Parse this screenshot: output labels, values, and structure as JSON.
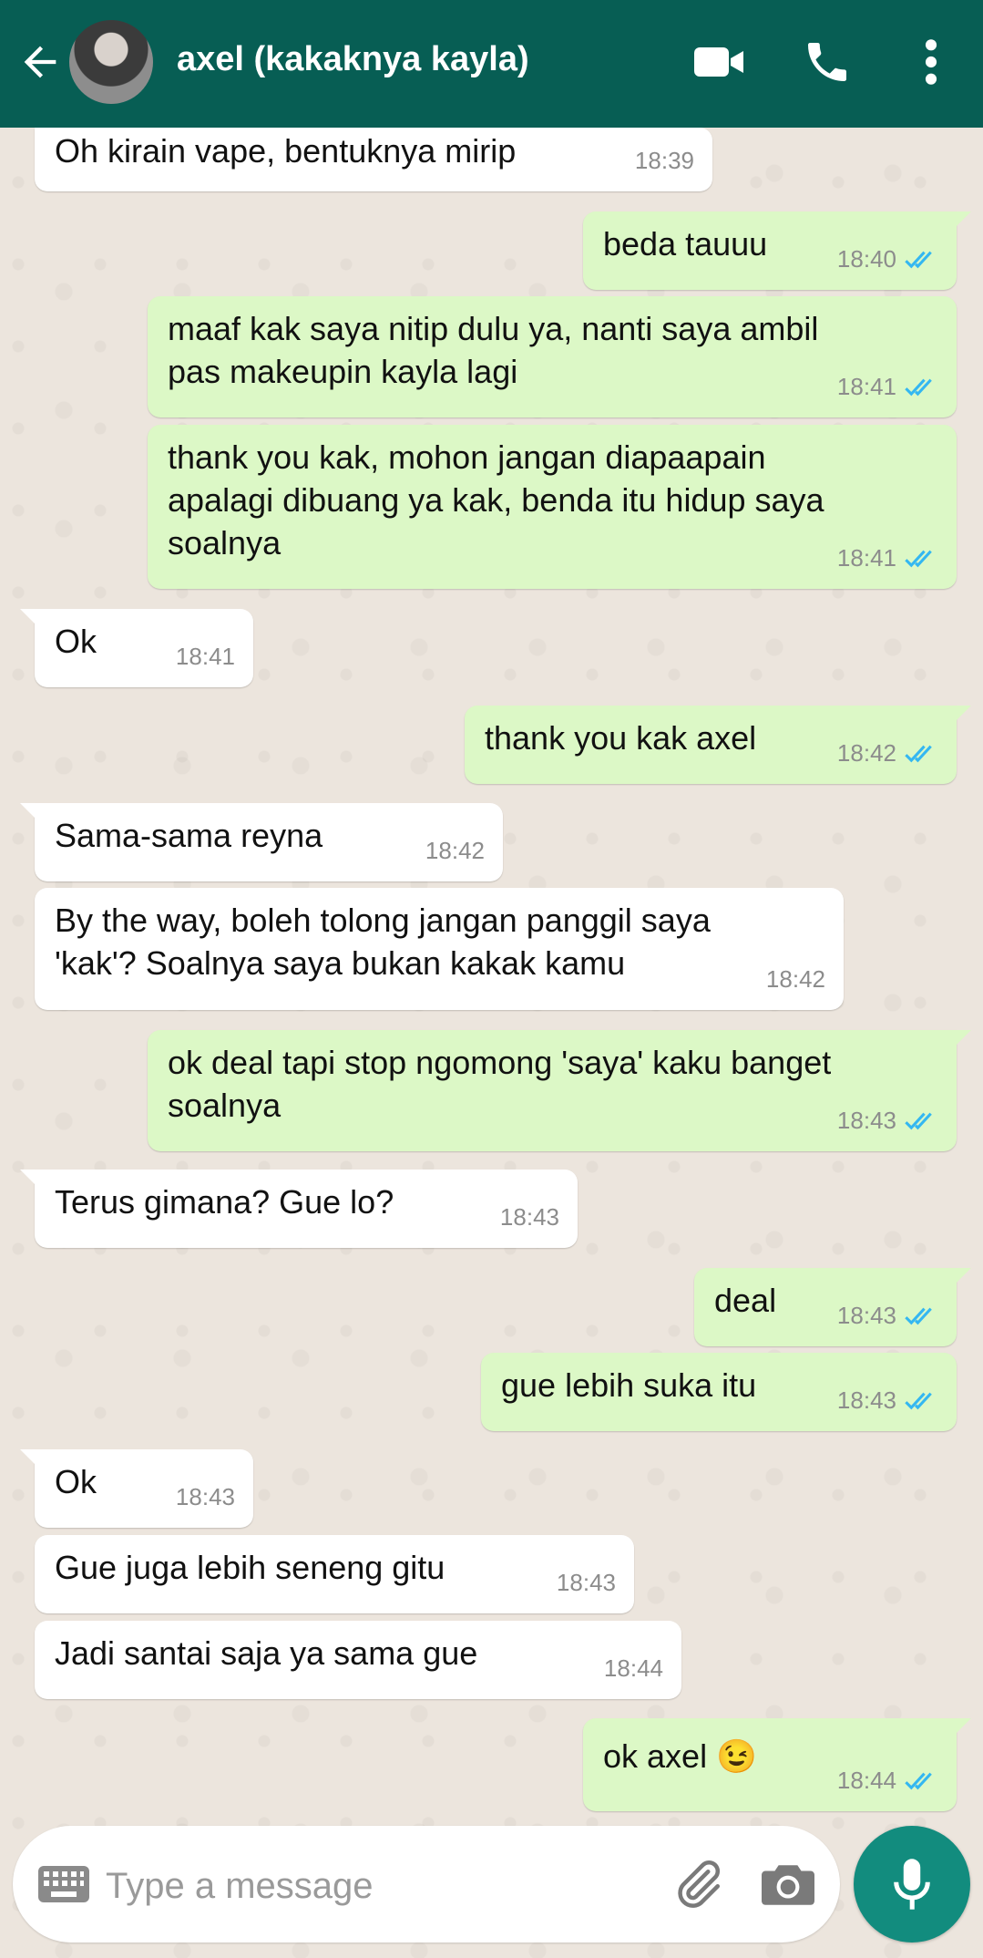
{
  "header": {
    "title": "axel (kakaknya kayla)",
    "back_icon": "arrow-left-icon",
    "video_icon": "video-call-icon",
    "call_icon": "phone-icon",
    "menu_icon": "more-vertical-icon",
    "color": "#075E54"
  },
  "messages": [
    {
      "dir": "in",
      "text": "Oh kirain vape, bentuknya mirip",
      "time": "18:39"
    },
    {
      "dir": "out",
      "text": "beda tauuu",
      "time": "18:40"
    },
    {
      "dir": "out",
      "text": "maaf kak saya nitip dulu ya, nanti saya ambil\npas makeupin kayla lagi",
      "time": "18:41"
    },
    {
      "dir": "out",
      "text": "thank you kak, mohon jangan diapaapain\napalagi dibuang ya kak, benda itu hidup saya\nsoalnya",
      "time": "18:41"
    },
    {
      "dir": "in",
      "text": "Ok",
      "time": "18:41"
    },
    {
      "dir": "out",
      "text": "thank you kak axel",
      "time": "18:42"
    },
    {
      "dir": "in",
      "text": "Sama-sama reyna",
      "time": "18:42"
    },
    {
      "dir": "in",
      "text": "By the way, boleh tolong jangan panggil saya\n'kak'? Soalnya saya bukan kakak kamu",
      "time": "18:42"
    },
    {
      "dir": "out",
      "text": "ok deal tapi stop ngomong 'saya' kaku banget\nsoalnya",
      "time": "18:43"
    },
    {
      "dir": "in",
      "text": "Terus gimana? Gue lo?",
      "time": "18:43"
    },
    {
      "dir": "out",
      "text": "deal",
      "time": "18:43"
    },
    {
      "dir": "out",
      "text": "gue lebih suka itu",
      "time": "18:43"
    },
    {
      "dir": "in",
      "text": "Ok",
      "time": "18:43"
    },
    {
      "dir": "in",
      "text": "Gue juga lebih seneng gitu",
      "time": "18:43"
    },
    {
      "dir": "in",
      "text": "Jadi santai saja ya sama gue",
      "time": "18:44"
    },
    {
      "dir": "out",
      "text": "ok axel 😉",
      "time": "18:44"
    }
  ],
  "composer": {
    "placeholder": "Type a message",
    "keyboard_icon": "keyboard-icon",
    "attach_icon": "paperclip-icon",
    "camera_icon": "camera-icon",
    "mic_icon": "microphone-icon"
  },
  "colors": {
    "incoming_bubble": "#FFFFFF",
    "outgoing_bubble": "#DCF8C6",
    "read_ticks": "#34B7F1",
    "wallpaper": "#ECE5DD",
    "mic_button": "#128C7E"
  }
}
